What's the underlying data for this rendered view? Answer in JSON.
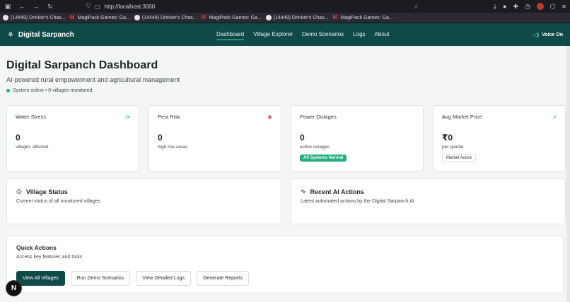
{
  "browser": {
    "url": "http://localhost:3000",
    "bookmarks": [
      {
        "label": "(14449) Drinker's Chas...",
        "icon": "circle"
      },
      {
        "label": "MagiPack Games: Ga...",
        "icon": "m"
      },
      {
        "label": "(14449) Drinker's Chas...",
        "icon": "circle"
      },
      {
        "label": "MagiPack Games: Ga...",
        "icon": "m"
      },
      {
        "label": "(14449) Drinker's Chas...",
        "icon": "circle"
      },
      {
        "label": "MagiPack Games: Ga...",
        "icon": "m"
      }
    ]
  },
  "header": {
    "brand": "Digital Sarpanch",
    "nav": [
      "Dashboard",
      "Village Explorer",
      "Demo Scenarios",
      "Logs",
      "About"
    ],
    "active_nav": "Dashboard",
    "voice_label": "Voice On"
  },
  "page": {
    "title": "Digital Sarpanch Dashboard",
    "subtitle": "AI-powered rural empowerment and agricultural management",
    "status": "System online • 0 villages monitored"
  },
  "stats": [
    {
      "title": "Water Stress",
      "value": "0",
      "desc": "villages affected",
      "icon": "droplet-icon",
      "icon_glyph": "⟳",
      "icon_color": "#22b07d"
    },
    {
      "title": "Pest Risk",
      "value": "0",
      "desc": "high risk areas",
      "icon": "bug-icon",
      "icon_glyph": "✱",
      "icon_color": "#e04848"
    },
    {
      "title": "Power Outages",
      "value": "0",
      "desc": "active outages",
      "badge": "All Systems Normal",
      "icon": "zap-icon",
      "icon_glyph": "",
      "icon_color": "#cccccc"
    },
    {
      "title": "Avg Market Price",
      "value": "₹0",
      "desc": "per quintal",
      "badge": "Market Active",
      "icon": "trending-up-icon",
      "icon_glyph": "↗",
      "icon_color": "#22b07d"
    }
  ],
  "panels": [
    {
      "title": "Village Status",
      "desc": "Current status of all monitored villages",
      "icon_glyph": "◎"
    },
    {
      "title": "Recent AI Actions",
      "desc": "Latest automated actions by the Digital Sarpanch AI",
      "icon_glyph": "∿"
    }
  ],
  "quick_actions": {
    "title": "Quick Actions",
    "desc": "Access key features and tools",
    "buttons": [
      "View All Villages",
      "Run Demo Scenarios",
      "View Detailed Logs",
      "Generate Reports"
    ]
  },
  "floating_badge": "N",
  "colors": {
    "header_bg": "#0f4a48",
    "accent_green": "#22b07d",
    "danger": "#e04848"
  }
}
